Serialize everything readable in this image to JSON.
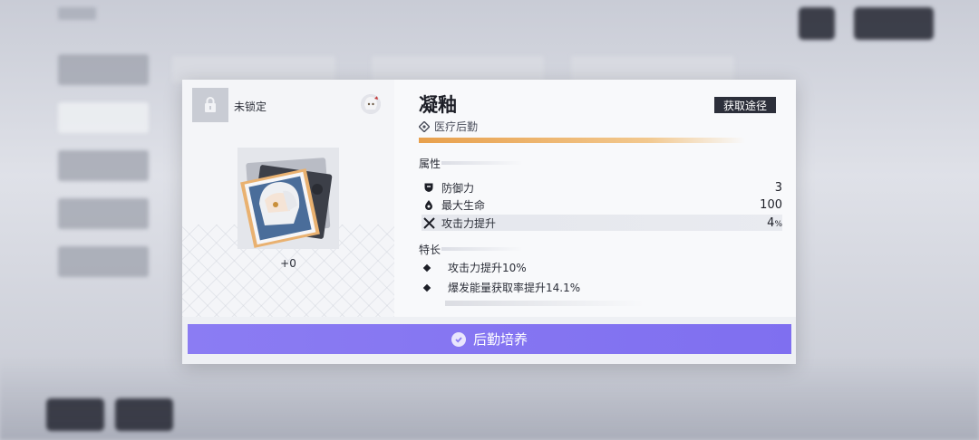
{
  "item": {
    "lock_label": "未锁定",
    "level": "+0",
    "name": "凝釉",
    "type": "医疗后勤",
    "source_button": "获取途径"
  },
  "attributes": {
    "section_label": "属性",
    "stats": [
      {
        "icon": "shield-icon",
        "name": "防御力",
        "value": "3"
      },
      {
        "icon": "drop-icon",
        "name": "最大生命",
        "value": "100"
      },
      {
        "icon": "crossed-swords-icon",
        "name": "攻击力提升",
        "value": "4",
        "unit": "%"
      }
    ]
  },
  "traits": {
    "section_label": "特长",
    "items": [
      "攻击力提升10%",
      "爆发能量获取率提升14.1%"
    ]
  },
  "action": {
    "train_button": "后勤培养"
  },
  "colors": {
    "accent": "#8b7cf3",
    "rarity_bar": "#e8a04c",
    "dark_button": "#2c2f3a"
  }
}
